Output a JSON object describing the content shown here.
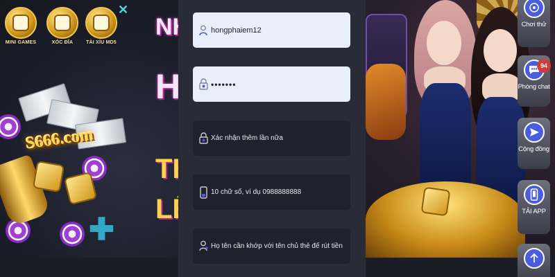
{
  "left_banner": {
    "games": [
      {
        "label": "MINI GAMES"
      },
      {
        "label": "XÓC ĐĨA"
      },
      {
        "label": "TÀI XỈU MD5"
      }
    ],
    "brand_logo": "S666.com",
    "headline_fragments": [
      "NH",
      "H",
      "TH",
      "LÊ"
    ]
  },
  "form": {
    "username": {
      "value": "hongphaiem12",
      "icon": "user-icon"
    },
    "password": {
      "value": "•••••••",
      "icon": "lock-icon"
    },
    "confirm_password": {
      "placeholder": "Xác nhận thêm lần nữa",
      "icon": "lock-icon"
    },
    "phone": {
      "placeholder": "10 chữ số, ví dụ 0988888888",
      "icon": "phone-icon"
    },
    "fullname": {
      "placeholder": "Họ tên cần khớp với tên chủ thẻ để rút tiền",
      "icon": "user-add-icon"
    }
  },
  "side_menu": {
    "items": [
      {
        "label": "Chơi thử",
        "icon": "game-icon"
      },
      {
        "label": "Phòng chat",
        "icon": "chat-icon",
        "badge": "94"
      },
      {
        "label": "Cộng đồng",
        "icon": "send-icon"
      },
      {
        "label": "TẢI APP",
        "icon": "mobile-icon"
      },
      {
        "label": "",
        "icon": "arrow-up-icon"
      }
    ]
  },
  "colors": {
    "form_panel_bg": "#292c37",
    "field_light_bg": "#e9eefb",
    "field_dark_bg": "#1f222c",
    "accent_blue": "#4a5de0",
    "badge_red": "#d23b3b"
  }
}
